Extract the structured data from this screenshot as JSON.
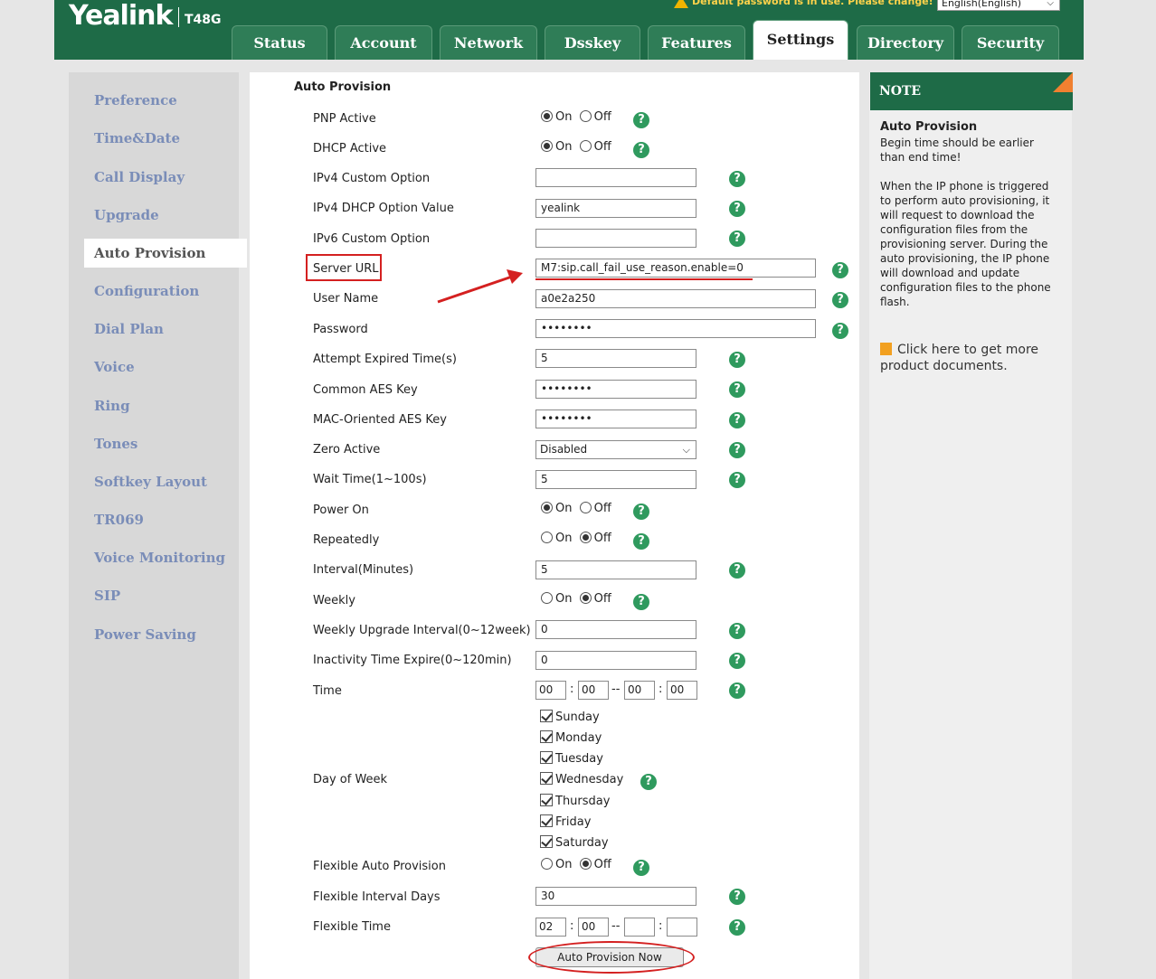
{
  "header": {
    "logo": "Yealink",
    "model": "T48G",
    "warning": "Default password is in use. Please change!",
    "language": "English(English)"
  },
  "tabs": [
    "Status",
    "Account",
    "Network",
    "Dsskey",
    "Features",
    "Settings",
    "Directory",
    "Security"
  ],
  "active_tab": "Settings",
  "sidebar": {
    "items": [
      "Preference",
      "Time&Date",
      "Call Display",
      "Upgrade",
      "Auto Provision",
      "Configuration",
      "Dial Plan",
      "Voice",
      "Ring",
      "Tones",
      "Softkey Layout",
      "TR069",
      "Voice Monitoring",
      "SIP",
      "Power Saving"
    ],
    "active": "Auto Provision"
  },
  "form": {
    "section_title": "Auto Provision",
    "radio_on": "On",
    "radio_off": "Off",
    "help": "?",
    "colon": ":",
    "dash": "--",
    "pnp_active": {
      "label": "PNP Active",
      "value": "On"
    },
    "dhcp_active": {
      "label": "DHCP Active",
      "value": "On"
    },
    "ipv4_custom_option": {
      "label": "IPv4 Custom Option",
      "value": ""
    },
    "ipv4_dhcp_option_value": {
      "label": "IPv4 DHCP Option Value",
      "value": "yealink"
    },
    "ipv6_custom_option": {
      "label": "IPv6 Custom Option",
      "value": ""
    },
    "server_url": {
      "label": "Server URL",
      "value": "M7:sip.call_fail_use_reason.enable=0"
    },
    "user_name": {
      "label": "User Name",
      "value": "a0e2a250"
    },
    "password": {
      "label": "Password",
      "value": "••••••••"
    },
    "attempt_expired_time": {
      "label": "Attempt Expired Time(s)",
      "value": "5"
    },
    "common_aes_key": {
      "label": "Common AES Key",
      "value": "••••••••"
    },
    "mac_aes_key": {
      "label": "MAC-Oriented AES Key",
      "value": "••••••••"
    },
    "zero_active": {
      "label": "Zero Active",
      "value": "Disabled"
    },
    "wait_time": {
      "label": "Wait Time(1~100s)",
      "value": "5"
    },
    "power_on": {
      "label": "Power On",
      "value": "On"
    },
    "repeatedly": {
      "label": "Repeatedly",
      "value": "Off"
    },
    "interval": {
      "label": "Interval(Minutes)",
      "value": "5"
    },
    "weekly": {
      "label": "Weekly",
      "value": "Off"
    },
    "weekly_upgrade_interval": {
      "label": "Weekly Upgrade Interval(0~12week)",
      "value": "0"
    },
    "inactivity_time_expire": {
      "label": "Inactivity Time Expire(0~120min)",
      "value": "0"
    },
    "time": {
      "label": "Time",
      "values": [
        "00",
        "00",
        "00",
        "00"
      ]
    },
    "day_of_week": {
      "label": "Day of Week",
      "days": [
        {
          "name": "Sunday",
          "checked": true
        },
        {
          "name": "Monday",
          "checked": true
        },
        {
          "name": "Tuesday",
          "checked": true
        },
        {
          "name": "Wednesday",
          "checked": true
        },
        {
          "name": "Thursday",
          "checked": true
        },
        {
          "name": "Friday",
          "checked": true
        },
        {
          "name": "Saturday",
          "checked": true
        }
      ]
    },
    "flexible_auto_provision": {
      "label": "Flexible Auto Provision",
      "value": "Off"
    },
    "flexible_interval_days": {
      "label": "Flexible Interval Days",
      "value": "30"
    },
    "flexible_time": {
      "label": "Flexible Time",
      "values": [
        "02",
        "00",
        "",
        ""
      ]
    },
    "auto_provision_now": "Auto Provision Now"
  },
  "note": {
    "header": "NOTE",
    "title": "Auto Provision",
    "text1": "Begin time should be earlier than end time!",
    "text2": "When the IP phone is triggered to perform auto provisioning, it will request to download the configuration files from the provisioning server. During the auto provisioning, the IP phone will download and update configuration files to the phone flash.",
    "link": "Click here to get more product documents."
  },
  "colors": {
    "brand_green": "#1e6b47",
    "annotation_red": "#d42020",
    "help_green": "#2f9a5e",
    "sidebar_link": "#7a8db8",
    "note_accent": "#f08030"
  }
}
